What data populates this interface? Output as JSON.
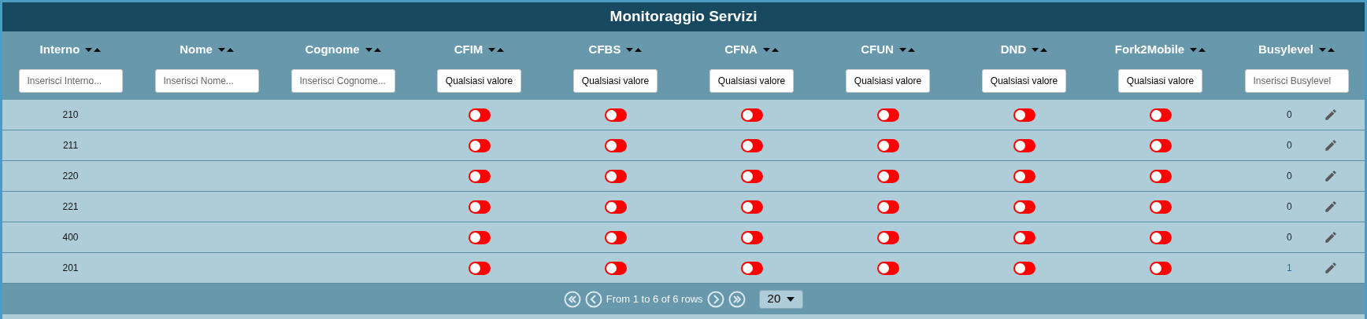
{
  "title": "Monitoraggio Servizi",
  "columns": [
    {
      "label": "Interno",
      "filter": {
        "kind": "text",
        "placeholder": "Inserisci Interno..."
      }
    },
    {
      "label": "Nome",
      "filter": {
        "kind": "text",
        "placeholder": "Inserisci Nome..."
      }
    },
    {
      "label": "Cognome",
      "filter": {
        "kind": "text",
        "placeholder": "Inserisci Cognome..."
      }
    },
    {
      "label": "CFIM",
      "filter": {
        "kind": "select",
        "value": "Qualsiasi valore"
      }
    },
    {
      "label": "CFBS",
      "filter": {
        "kind": "select",
        "value": "Qualsiasi valore"
      }
    },
    {
      "label": "CFNA",
      "filter": {
        "kind": "select",
        "value": "Qualsiasi valore"
      }
    },
    {
      "label": "CFUN",
      "filter": {
        "kind": "select",
        "value": "Qualsiasi valore"
      }
    },
    {
      "label": "DND",
      "filter": {
        "kind": "select",
        "value": "Qualsiasi valore"
      }
    },
    {
      "label": "Fork2Mobile",
      "filter": {
        "kind": "select",
        "value": "Qualsiasi valore"
      }
    },
    {
      "label": "Busylevel",
      "filter": {
        "kind": "text",
        "placeholder": "Inserisci Busylevel"
      }
    }
  ],
  "rows": [
    {
      "interno": "210",
      "switches": [
        {
          "on": false
        },
        {
          "on": false
        },
        {
          "on": false
        },
        {
          "on": false
        },
        {
          "on": false
        },
        {
          "on": false
        }
      ],
      "busylevel": "0",
      "busylevel_link": false
    },
    {
      "interno": "211",
      "switches": [
        {
          "on": false
        },
        {
          "on": false
        },
        {
          "on": false
        },
        {
          "on": false
        },
        {
          "on": false
        },
        {
          "on": false
        }
      ],
      "busylevel": "0",
      "busylevel_link": false
    },
    {
      "interno": "220",
      "switches": [
        {
          "on": false
        },
        {
          "on": false
        },
        {
          "on": false
        },
        {
          "on": false
        },
        {
          "on": false
        },
        {
          "on": false
        }
      ],
      "busylevel": "0",
      "busylevel_link": false
    },
    {
      "interno": "221",
      "switches": [
        {
          "on": false
        },
        {
          "on": false
        },
        {
          "on": false
        },
        {
          "on": false
        },
        {
          "on": false
        },
        {
          "on": false
        }
      ],
      "busylevel": "0",
      "busylevel_link": false
    },
    {
      "interno": "400",
      "switches": [
        {
          "on": false
        },
        {
          "on": false
        },
        {
          "on": false
        },
        {
          "on": false
        },
        {
          "on": false
        },
        {
          "on": false
        }
      ],
      "busylevel": "0",
      "busylevel_link": false
    },
    {
      "interno": "201",
      "switches": [
        {
          "on": false
        },
        {
          "on": false
        },
        {
          "on": false
        },
        {
          "on": false
        },
        {
          "on": false
        },
        {
          "on": false
        }
      ],
      "busylevel": "1",
      "busylevel_link": true
    }
  ],
  "pagination": {
    "info": "From 1 to 6 of 6 rows",
    "page_size": "20"
  }
}
